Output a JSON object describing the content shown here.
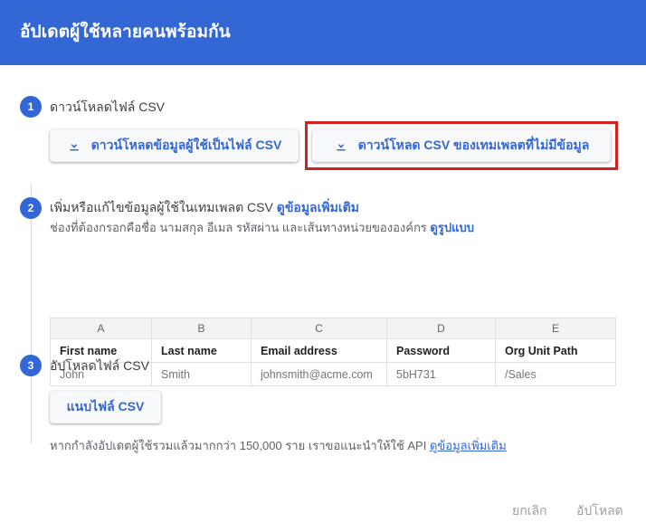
{
  "header": {
    "title": "อัปเดตผู้ใช้หลายคนพร้อมกัน"
  },
  "steps": [
    {
      "number": "1",
      "title": "ดาวน์โหลดไฟล์ CSV",
      "buttons": [
        {
          "label": "ดาวน์โหลดข้อมูลผู้ใช้เป็นไฟล์ CSV",
          "icon": "download-icon"
        },
        {
          "label": "ดาวน์โหลด CSV ของเทมเพลตที่ไม่มีข้อมูล",
          "icon": "download-icon",
          "highlighted": true
        }
      ]
    },
    {
      "number": "2",
      "title_text": "เพิ่มหรือแก้ไขข้อมูลผู้ใช้ในเทมเพลต CSV ",
      "title_link": "ดูข้อมูลเพิ่มเติม",
      "sub_text": "ช่องที่ต้องกรอกคือชื่อ นามสกุล อีเมล รหัสผ่าน และเส้นทางหน่วยขององค์กร ",
      "sub_link": "ดูรูปแบบ"
    },
    {
      "number": "3",
      "title": "อัปโหลดไฟล์ CSV",
      "attach_label": "แนบไฟล์ CSV"
    }
  ],
  "table": {
    "column_letters": [
      "A",
      "B",
      "C",
      "D",
      "E"
    ],
    "field_headers": [
      "First name",
      "Last name",
      "Email address",
      "Password",
      "Org Unit Path"
    ],
    "rows": [
      [
        "John",
        "Smith",
        "johnsmith@acme.com",
        "5bH731",
        "/Sales"
      ]
    ]
  },
  "note": {
    "text": "หากกำลังอัปเดตผู้ใช้รวมแล้วมากกว่า 150,000 ราย เราขอแนะนำให้ใช้ API ",
    "link": "ดูข้อมูลเพิ่มเติม"
  },
  "footer": {
    "cancel_label": "ยกเลิก",
    "upload_label": "อัปโหลด"
  },
  "colors": {
    "header_blue": "#3367d6",
    "link_blue": "#3367d6",
    "highlight_red": "#d32121",
    "disabled_gray": "#9aa0a6"
  }
}
